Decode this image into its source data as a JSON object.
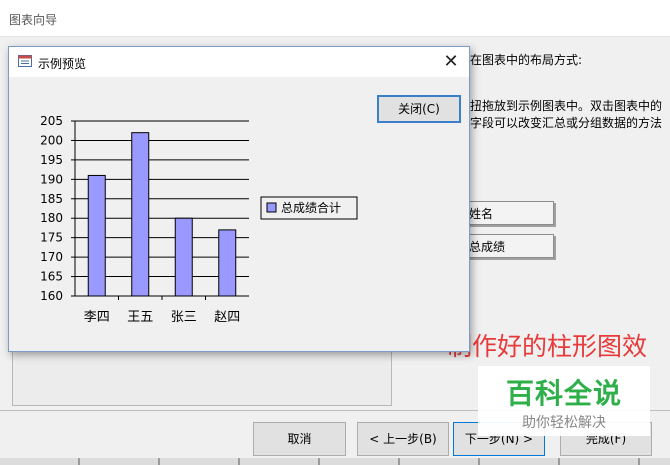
{
  "wizard": {
    "title": "图表向导",
    "instructions": [
      "在图表中的布局方式:",
      "扭拖放到示例图表中。双击图表中的",
      "字段可以改变汇总或分组数据的方法"
    ],
    "fields": [
      "姓名",
      "总成绩"
    ],
    "buttons": {
      "cancel": "取消",
      "back": "< 上一步(B)",
      "next": "下一步(N) >",
      "finish": "完成(F)"
    }
  },
  "dialog": {
    "title": "示例预览",
    "close_button": "关闭(C)",
    "close_x": "✕"
  },
  "annotation": {
    "text": "制作好的柱形图效",
    "color": "#e83a3a"
  },
  "watermark": {
    "title": "百科全说",
    "subtitle": "助你轻松解决"
  },
  "chart_data": {
    "type": "bar",
    "categories": [
      "李四",
      "王五",
      "张三",
      "赵四"
    ],
    "series": [
      {
        "name": "总成绩合计",
        "values": [
          191,
          202,
          180,
          177
        ],
        "color": "#9999ff"
      }
    ],
    "ylim": [
      160,
      205
    ],
    "yticks": [
      160,
      165,
      170,
      175,
      180,
      185,
      190,
      195,
      200,
      205
    ],
    "grid": true,
    "legend": "right"
  }
}
